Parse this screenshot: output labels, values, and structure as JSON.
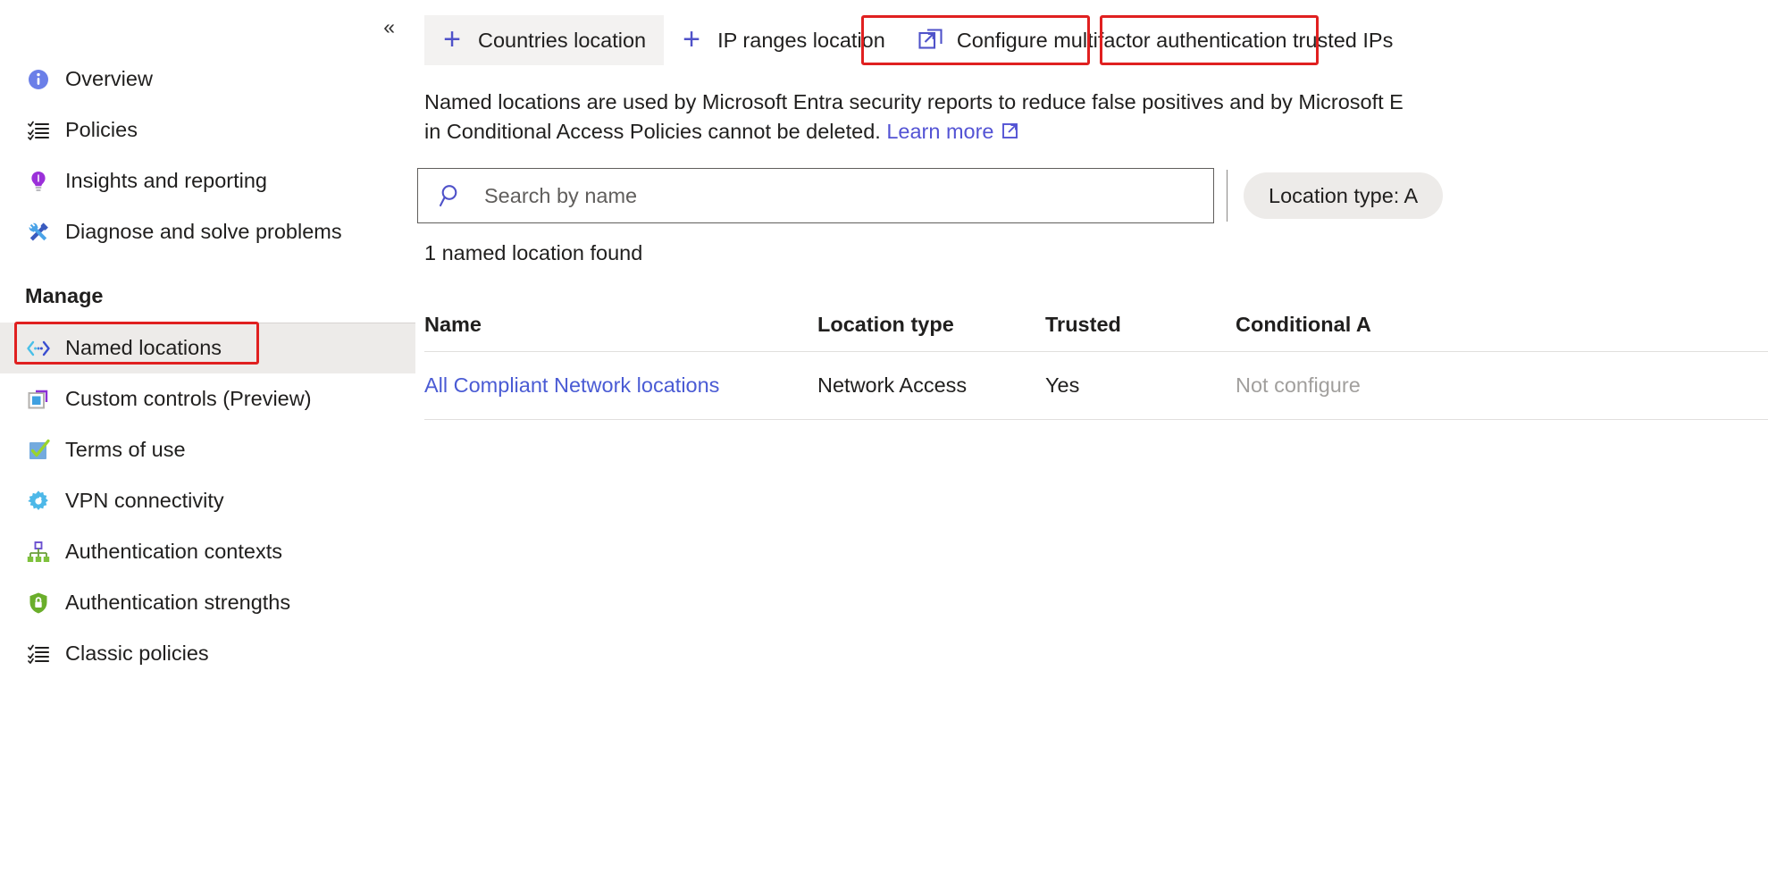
{
  "sidebar": {
    "collapse_glyph": "«",
    "items": [
      {
        "label": "Overview",
        "icon": "info-icon"
      },
      {
        "label": "Policies",
        "icon": "checklist-icon"
      },
      {
        "label": "Insights and reporting",
        "icon": "lightbulb-icon"
      },
      {
        "label": "Diagnose and solve problems",
        "icon": "wrench-screwdriver-icon"
      }
    ],
    "manage_header": "Manage",
    "manage_items": [
      {
        "label": "Named locations",
        "icon": "named-locations-icon",
        "selected": true
      },
      {
        "label": "Custom controls (Preview)",
        "icon": "custom-controls-icon",
        "selected": false
      },
      {
        "label": "Terms of use",
        "icon": "checkbox-green-icon",
        "selected": false
      },
      {
        "label": "VPN connectivity",
        "icon": "gear-icon",
        "selected": false
      },
      {
        "label": "Authentication contexts",
        "icon": "hierarchy-icon",
        "selected": false
      },
      {
        "label": "Authentication strengths",
        "icon": "shield-lock-icon",
        "selected": false
      },
      {
        "label": "Classic policies",
        "icon": "checklist-icon",
        "selected": false
      }
    ]
  },
  "toolbar": {
    "countries_location": "Countries location",
    "ip_ranges_location": "IP ranges location",
    "configure_mfa_trusted_ips": "Configure multifactor authentication trusted IPs"
  },
  "description": {
    "line1": "Named locations are used by Microsoft Entra security reports to reduce false positives and by Microsoft E",
    "line2": "in Conditional Access Policies cannot be deleted.",
    "learn_more": "Learn more"
  },
  "search": {
    "placeholder": "Search by name"
  },
  "filter": {
    "location_type_pill": "Location type: A"
  },
  "results": {
    "count_text": "1 named location found"
  },
  "table": {
    "columns": [
      "Name",
      "Location type",
      "Trusted",
      "Conditional A"
    ],
    "rows": [
      {
        "name": "All Compliant Network locations",
        "location_type": "Network Access",
        "trusted": "Yes",
        "conditional_access": "Not configure"
      }
    ]
  },
  "colors": {
    "annotation_red": "#e02020",
    "accent_blue": "#4f52c9",
    "link_blue": "#4a5bd4",
    "selected_bg": "#edebe9"
  }
}
